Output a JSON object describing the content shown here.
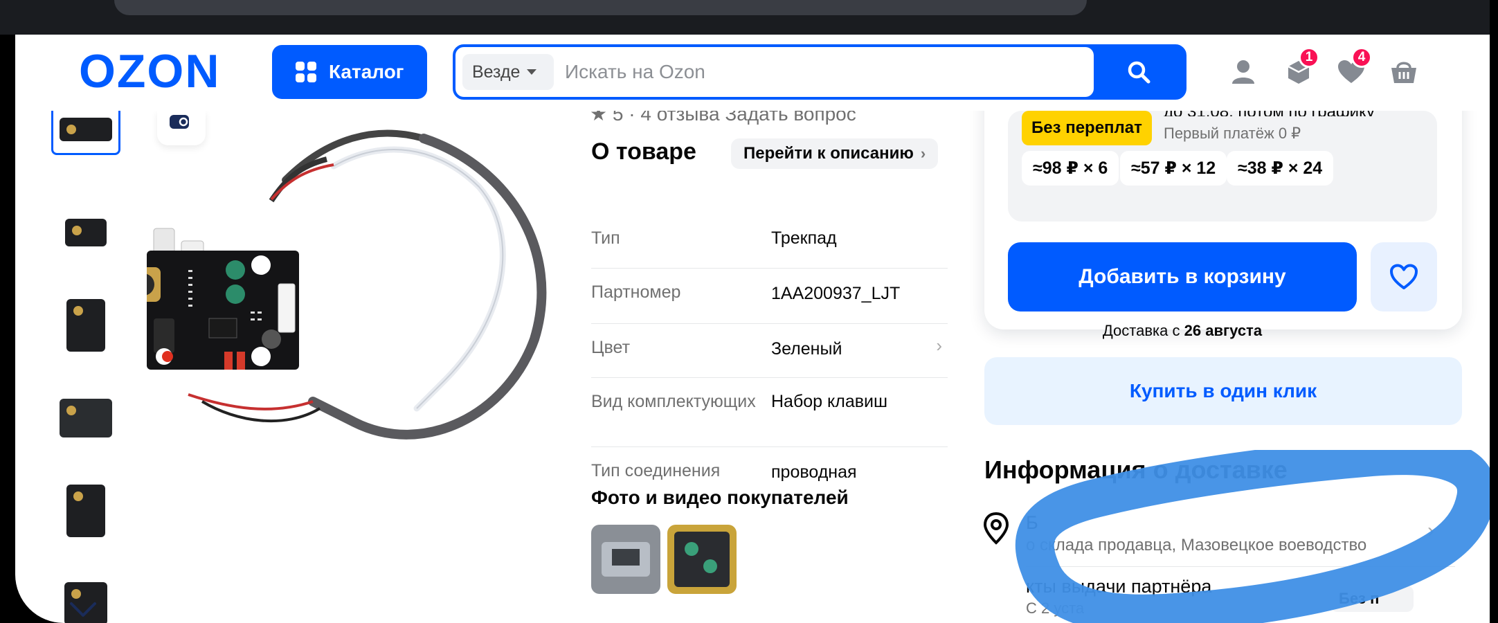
{
  "header": {
    "logo_text": "OZON",
    "catalog_label": "Каталог",
    "search_scope": "Везде",
    "search_placeholder": "Искать на Ozon",
    "orders_badge": "1",
    "favorites_badge": "4"
  },
  "colors": {
    "brand": "#005bff",
    "badge": "#f91155",
    "yellow": "#ffd200",
    "scribble": "#3f8fe6"
  },
  "icons": [
    "grid-icon",
    "search-icon",
    "user-icon",
    "orders-icon",
    "heart-icon",
    "cart-icon",
    "zoom-icon",
    "chevron-down-icon",
    "location-pin-icon",
    "chevron-right-icon"
  ],
  "product": {
    "rating_partial": "★ 5 · 4 отзыва   Задать вопрос"
  },
  "about": {
    "title": "О товаре",
    "goto_description": "Перейти к описанию",
    "properties": [
      {
        "key": "Тип",
        "value": "Трекпад"
      },
      {
        "key": "Партномер",
        "value": "1AA200937_LJT"
      },
      {
        "key": "Цвет",
        "value": "Зеленый"
      },
      {
        "key": "Вид комплектующих",
        "value": "Набор клавиш"
      },
      {
        "key": "Тип соединения",
        "value": "проводная"
      }
    ],
    "photos_title": "Фото и видео покупателей"
  },
  "buy": {
    "installment_top": "до 31.08, потом по графику",
    "no_overpay": "Без переплат",
    "first_payment": "Первый платёж 0 ₽",
    "chips": [
      "≈98 ₽ × 6",
      "≈57 ₽ × 12",
      "≈38 ₽ × 24"
    ],
    "add_to_cart": "Добавить в корзину",
    "delivery_from_prefix": "Доставка с",
    "delivery_from_date": "26 августа",
    "one_click": "Купить в один клик"
  },
  "delivery": {
    "title": "Информация о доставке",
    "line1": "Б",
    "line2": "о склада продавца, Мазовецкое воеводство",
    "line3": "кты выдачи партнёра",
    "line4": "С 2 уста",
    "badge": "Без п"
  }
}
